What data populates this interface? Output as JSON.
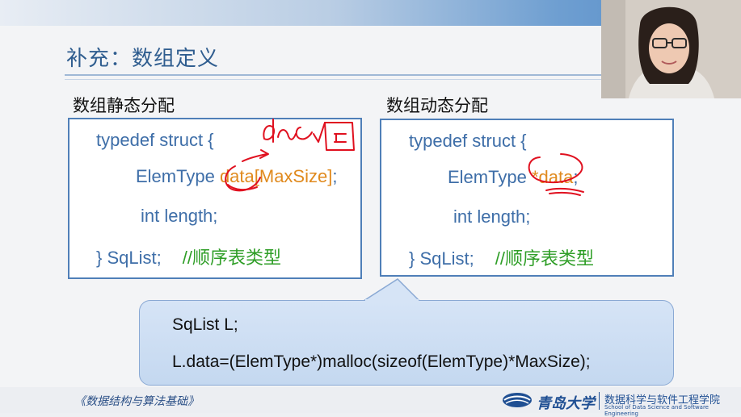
{
  "slide": {
    "title": "补充：数组定义",
    "static_heading": "数组静态分配",
    "dynamic_heading": "数组动态分配",
    "static_code": {
      "line1": "typedef struct {",
      "line2_type": "ElemType ",
      "line2_field": "data[MaxSize]",
      "line2_semicolon": ";",
      "line3": "int length;",
      "line4": "} SqList;",
      "line4_comment": "//顺序表类型"
    },
    "dynamic_code": {
      "line1": "typedef struct {",
      "line2_type": "ElemType ",
      "line2_field": "*data",
      "line2_semicolon": ";",
      "line3": "int length;",
      "line4": "} SqList;",
      "line4_comment": "//顺序表类型"
    },
    "callout": {
      "line1": "SqList L;",
      "line2": "L.data=(ElemType*)malloc(sizeof(ElemType)*MaxSize);"
    }
  },
  "footer": {
    "course": "《数据结构与算法基础》",
    "university": "青岛大学",
    "college": "数据科学与软件工程学院",
    "college_en": "School of Data Science and Software Engineering"
  },
  "colors": {
    "code_blue": "#3e6ea8",
    "keyword_orange": "#e08a1e",
    "comment_green": "#2f9e27",
    "annotation_red": "#e0101f",
    "box_border": "#4f7fb8"
  }
}
